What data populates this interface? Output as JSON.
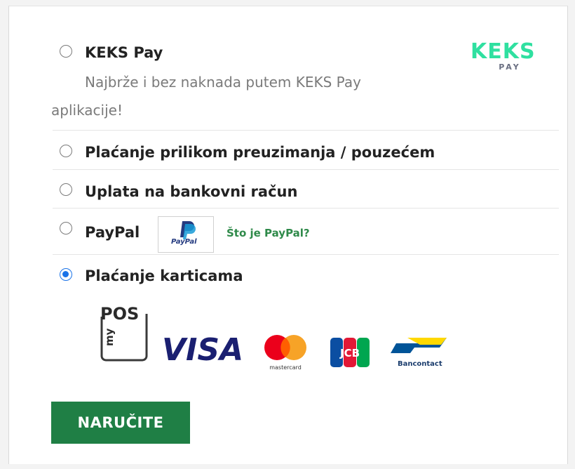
{
  "payment_options": [
    {
      "label": "KEKS Pay",
      "checked": false,
      "description_line1": "Najbrže i bez naknada putem KEKS Pay",
      "description_line2": "aplikacije!"
    },
    {
      "label": "Plaćanje prilikom preuzimanja / pouzećem",
      "checked": false
    },
    {
      "label": "Uplata na bankovni račun",
      "checked": false
    },
    {
      "label": "PayPal",
      "checked": false,
      "link": "Što je PayPal?",
      "logo_text": "PayPal"
    },
    {
      "label": "Plaćanje karticama",
      "checked": true
    }
  ],
  "keks_logo": {
    "word": "KEKS",
    "sub": "PAY"
  },
  "card_logos": {
    "mypos_top": "POS",
    "mypos_side": "my",
    "visa": "VISA",
    "mastercard": "mastercard",
    "jcb": "JCB",
    "bancontact": "Bancontact"
  },
  "submit_label": "NARUČITE",
  "colors": {
    "accent_green": "#1f7f45",
    "link_green": "#2f8a4a",
    "radio_blue": "#1a73e8",
    "keks_green": "#2fe0a0"
  }
}
